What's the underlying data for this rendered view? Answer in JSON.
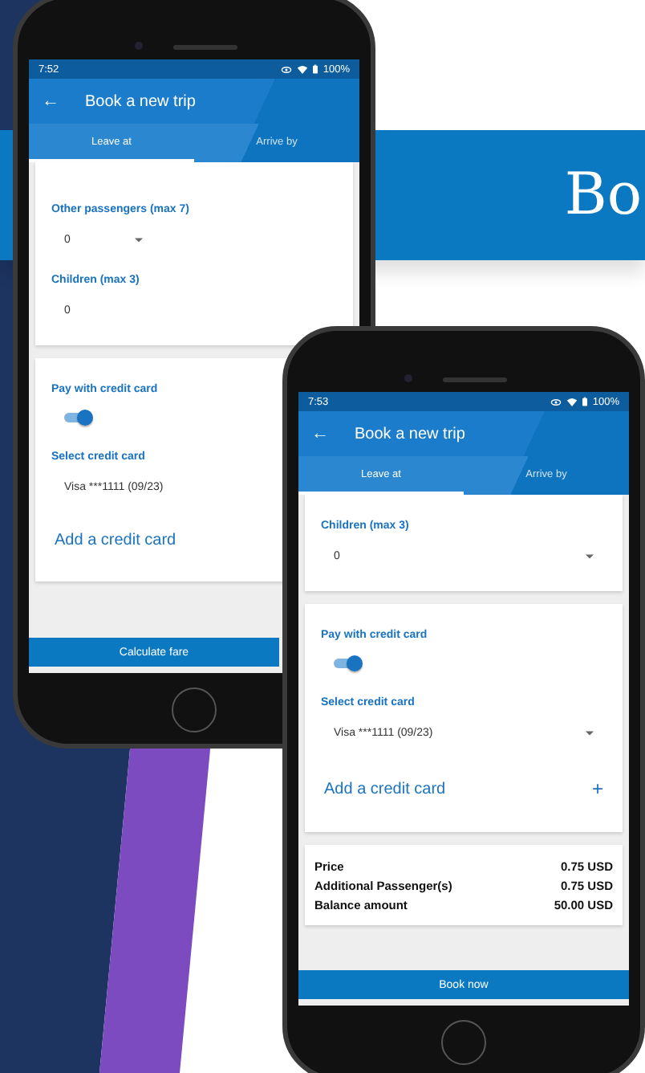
{
  "banner": {
    "text": "Bo"
  },
  "phones": [
    {
      "status": {
        "time": "7:52",
        "battery": "100%"
      },
      "title": "Book a new trip",
      "back": "←",
      "tabs": [
        {
          "label": "Leave at",
          "selected": true
        },
        {
          "label": "Arrive by",
          "selected": false
        }
      ],
      "cards": [
        {
          "items": [
            {
              "kind": "select",
              "label": "Other passengers (max 7)",
              "value": "0"
            },
            {
              "kind": "value",
              "label": "Children (max 3)",
              "value": "0"
            }
          ]
        },
        {
          "items": [
            {
              "kind": "toggle",
              "label": "Pay with credit card",
              "on": true
            },
            {
              "kind": "value",
              "label": "Select credit card",
              "value": "Visa ***1111 (09/23)"
            },
            {
              "kind": "link",
              "text": "Add a credit card"
            }
          ]
        }
      ],
      "button": "Calculate fare"
    },
    {
      "status": {
        "time": "7:53",
        "battery": "100%"
      },
      "title": "Book a new trip",
      "back": "←",
      "tabs": [
        {
          "label": "Leave at",
          "selected": true
        },
        {
          "label": "Arrive by",
          "selected": false
        }
      ],
      "cards": [
        {
          "items": [
            {
              "kind": "select",
              "label": "Children (max 3)",
              "value": "0"
            }
          ]
        },
        {
          "items": [
            {
              "kind": "toggle",
              "label": "Pay with credit card",
              "on": true
            },
            {
              "kind": "select",
              "label": "Select credit card",
              "value": "Visa ***1111 (09/23)"
            },
            {
              "kind": "link",
              "text": "Add a credit card",
              "action": "+"
            }
          ]
        }
      ],
      "summary": [
        {
          "label": "Price",
          "value": "0.75 USD"
        },
        {
          "label": "Additional Passenger(s)",
          "value": "0.75 USD"
        },
        {
          "label": "Balance amount",
          "value": "50.00 USD"
        }
      ],
      "button": "Book now"
    }
  ]
}
